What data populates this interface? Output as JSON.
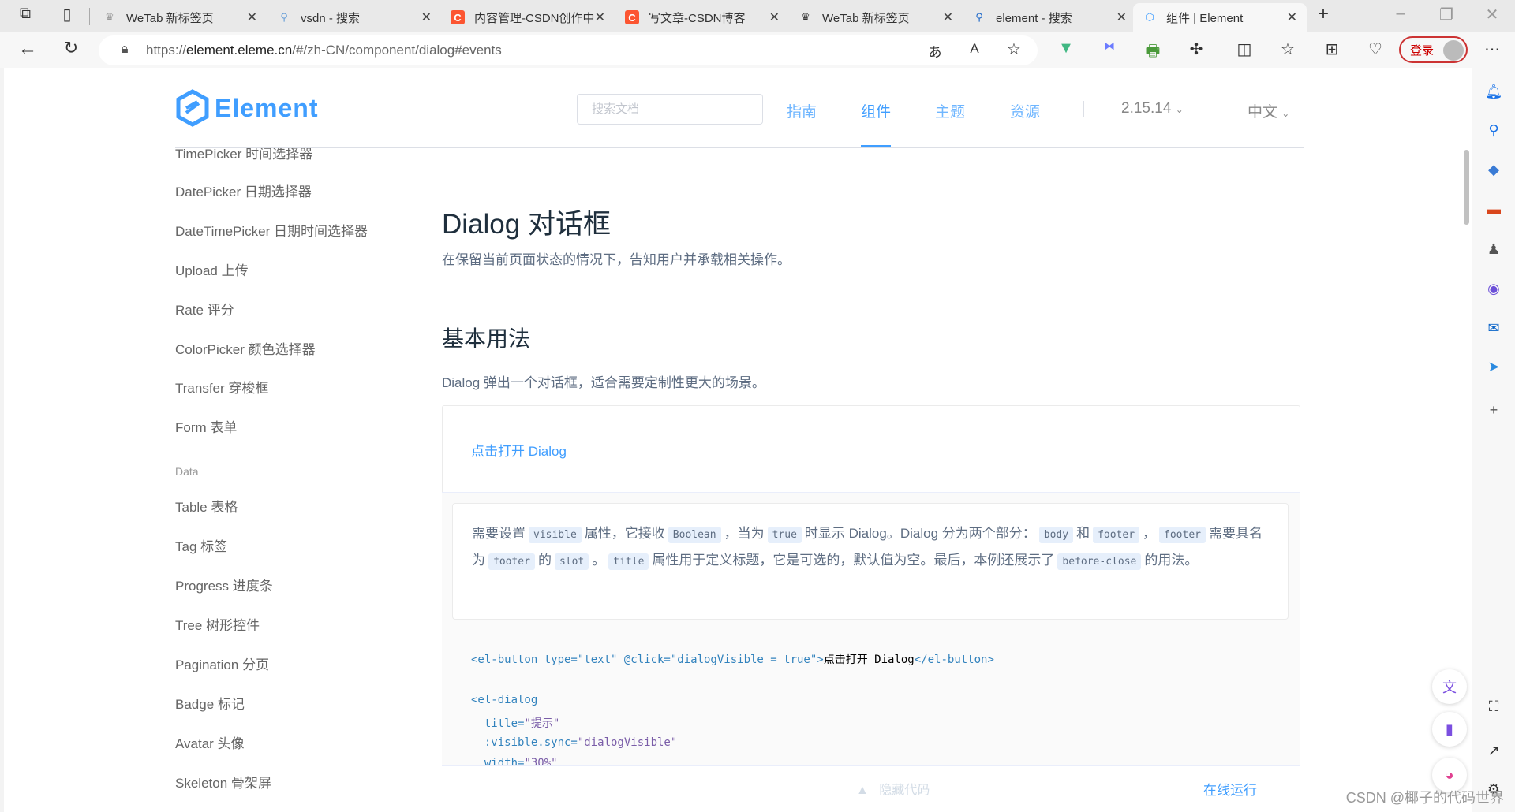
{
  "browser": {
    "tabs": [
      {
        "label": "WeTab 新标签页",
        "icon": "wetab-icon"
      },
      {
        "label": "vsdn - 搜索",
        "icon": "search-icon"
      },
      {
        "label": "内容管理-CSDN创作中心",
        "icon": "csdn-icon"
      },
      {
        "label": "写文章-CSDN博客",
        "icon": "csdn-icon"
      },
      {
        "label": "WeTab 新标签页",
        "icon": "wetab-icon"
      },
      {
        "label": "element - 搜索",
        "icon": "search-icon"
      },
      {
        "label": "组件 | Element",
        "icon": "element-icon",
        "active": true
      }
    ],
    "url_prefix": "https://",
    "url_host": "element.eleme.cn",
    "url_path": "/#/zh-CN/component/dialog#events",
    "login_label": "登录"
  },
  "header": {
    "logo": "Element",
    "search_placeholder": "搜索文档",
    "nav": [
      "指南",
      "组件",
      "主题",
      "资源"
    ],
    "version": "2.15.14",
    "language": "中文"
  },
  "sidebar": {
    "items_top": [
      "TimePicker 时间选择器",
      "DatePicker 日期选择器",
      "DateTimePicker 日期时间选择器",
      "Upload 上传",
      "Rate 评分",
      "ColorPicker 颜色选择器",
      "Transfer 穿梭框",
      "Form 表单"
    ],
    "group": "Data",
    "items_data": [
      "Table 表格",
      "Tag 标签",
      "Progress 进度条",
      "Tree 树形控件",
      "Pagination 分页",
      "Badge 标记",
      "Avatar 头像",
      "Skeleton 骨架屏"
    ]
  },
  "main": {
    "title": "Dialog 对话框",
    "subtitle": "在保留当前页面状态的情况下，告知用户并承载相关操作。",
    "section": "基本用法",
    "section_desc": "Dialog 弹出一个对话框，适合需要定制性更大的场景。",
    "demo_button": "点击打开 Dialog",
    "desc": {
      "t1": "需要设置",
      "c1": "visible",
      "t2": "属性，它接收",
      "c2": "Boolean",
      "t3": "，当为",
      "c3": "true",
      "t4": "时显示 Dialog。Dialog 分为两个部分：",
      "c4": "body",
      "t5": "和",
      "c5": "footer",
      "t6": "，",
      "c6": "footer",
      "t7": "需要具名为",
      "c7": "footer",
      "t8": "的",
      "c8": "slot",
      "t9": "。",
      "c9": "title",
      "t10": "属性用于定义标题，它是可选的，默认值为空。最后，本例还展示了",
      "c10": "before-close",
      "t11": "的用法。"
    },
    "code": {
      "l1a": "<el-button type=\"text\" @click=\"dialogVisible = true\">",
      "l1b": "点击打开 Dialog",
      "l1c": "</el-button>",
      "l2": "<el-dialog",
      "l3a": "  title=",
      "l3b": "\"提示\"",
      "l4a": "  :visible.sync=",
      "l4b": "\"dialogVisible\"",
      "l5a": "  width=",
      "l5b": "\"30%\""
    },
    "hide_code": "隐藏代码",
    "run_online": "在线运行"
  },
  "watermark": "CSDN @椰子的代码世界"
}
